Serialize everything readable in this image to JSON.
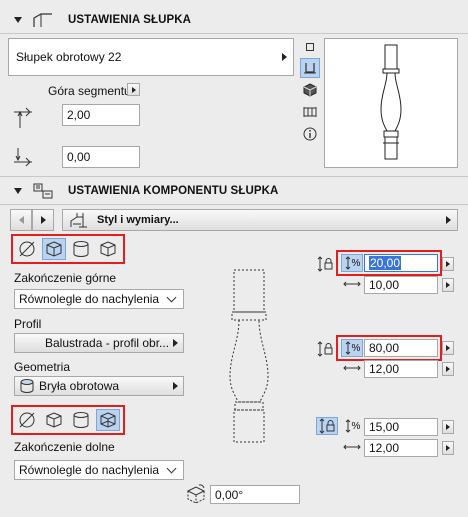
{
  "section1": {
    "title": "USTAWIENIA SŁUPKA",
    "post_name": "Słupek obrotowy 22",
    "segment_label": "Góra segmentu",
    "top_value": "2,00",
    "bottom_value": "0,00"
  },
  "section2": {
    "title": "USTAWIENIA KOMPONENTU SŁUPKA",
    "style_label": "Styl i wymiary...",
    "top_end_label": "Zakończenie górne",
    "top_end_value": "Równolegle do nachylenia",
    "profile_label": "Profil",
    "profile_value": "Balustrada - profil obr...",
    "geometry_label": "Geometria",
    "geometry_value": "Bryła obrotowa",
    "bottom_end_label": "Zakończenie dolne",
    "bottom_end_value": "Równolegle do nachylenia",
    "top_height_percent": "20,00",
    "top_width": "10,00",
    "mid_height_percent": "80,00",
    "mid_width": "12,00",
    "bottom_height_percent": "15,00",
    "bottom_width": "12,00",
    "rotation": "0,00°",
    "percent_symbol": "%"
  },
  "colors": {
    "highlight": "#e02020",
    "selected_bg": "#b9d3f0",
    "text_selection": "#3875d7"
  }
}
